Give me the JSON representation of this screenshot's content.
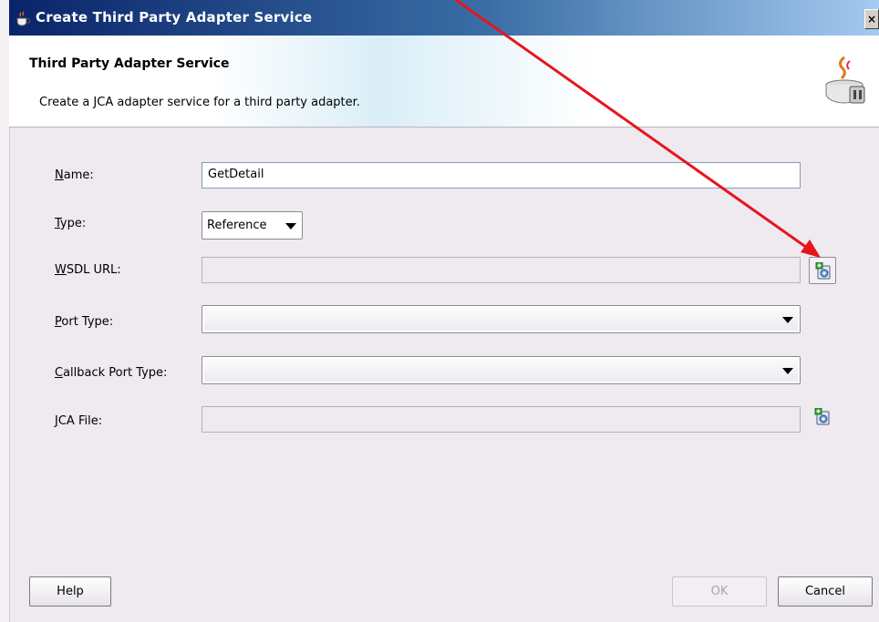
{
  "window": {
    "title": "Create Third Party Adapter Service",
    "close_label": "×"
  },
  "header": {
    "title": "Third Party Adapter Service",
    "description": "Create a JCA adapter service for a third party adapter."
  },
  "form": {
    "name": {
      "mnemonic": "N",
      "label_rest": "ame:",
      "value": "GetDetail"
    },
    "type": {
      "mnemonic": "T",
      "label_rest": "ype:",
      "value": "Reference"
    },
    "wsdl_url": {
      "mnemonic": "W",
      "label_rest": "SDL URL:",
      "value": ""
    },
    "port_type": {
      "mnemonic": "P",
      "label_rest": "ort Type:",
      "value": ""
    },
    "callback_port_type": {
      "mnemonic": "C",
      "label_rest": "allback Port Type:",
      "value": ""
    },
    "jca_file": {
      "mnemonic": "J",
      "label_rest": "CA File:",
      "value": ""
    }
  },
  "buttons": {
    "help": "Help",
    "ok": "OK",
    "cancel": "Cancel"
  },
  "colors": {
    "annotation_arrow": "#e8141c",
    "title_bar_start": "#0a246a",
    "dialog_background": "#efe9f0"
  },
  "icons": {
    "title": "coffee-cup-plug-icon",
    "header": "coffee-cup-plug-icon",
    "browse": "browse-add-icon"
  }
}
